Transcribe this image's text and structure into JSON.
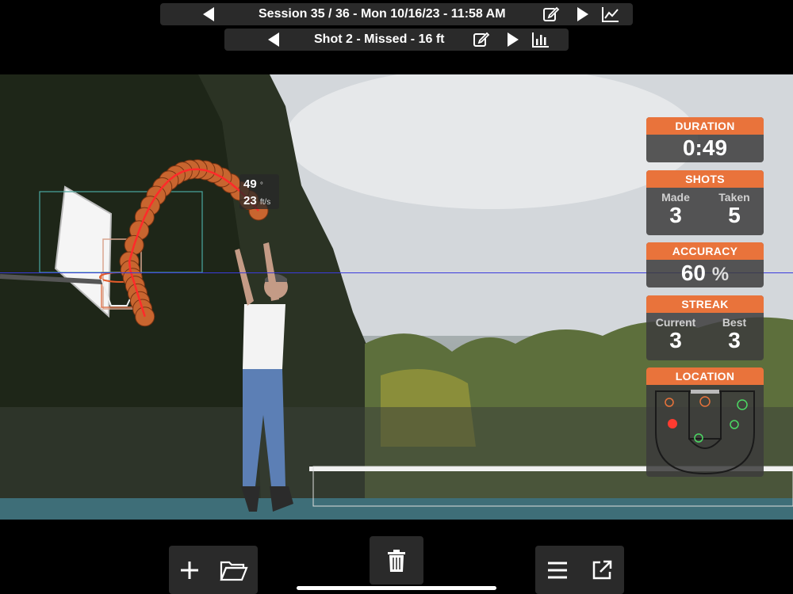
{
  "session_bar": {
    "title": "Session 35 / 36 - Mon 10/16/23 - 11:58 AM",
    "icons": [
      "prev-arrow-icon",
      "edit-icon",
      "next-arrow-icon",
      "line-chart-icon"
    ]
  },
  "shot_bar": {
    "title": "Shot 2 - Missed - 16 ft",
    "icons": [
      "prev-arrow-icon",
      "edit-icon",
      "next-arrow-icon",
      "bar-chart-icon"
    ]
  },
  "overlay": {
    "angle_value": "49",
    "angle_unit": "°",
    "speed_value": "23",
    "speed_unit": "ft/s"
  },
  "stats": {
    "duration": {
      "label": "DURATION",
      "value": "0:49"
    },
    "shots": {
      "label": "SHOTS",
      "made_label": "Made",
      "made": "3",
      "taken_label": "Taken",
      "taken": "5"
    },
    "accuracy": {
      "label": "ACCURACY",
      "value": "60",
      "unit": "%"
    },
    "streak": {
      "label": "STREAK",
      "current_label": "Current",
      "current": "3",
      "best_label": "Best",
      "best": "3"
    },
    "location": {
      "label": "LOCATION"
    }
  },
  "colors": {
    "accent": "#e9733b",
    "made": "#4cd964",
    "missed": "#e9733b",
    "current": "#ff3b30",
    "guide_line": "#3b3bdd"
  },
  "toolbar": {
    "left_icons": [
      "add-icon",
      "folder-icon"
    ],
    "mid_icons": [
      "trash-icon"
    ],
    "right_icons": [
      "menu-icon",
      "share-icon"
    ]
  }
}
